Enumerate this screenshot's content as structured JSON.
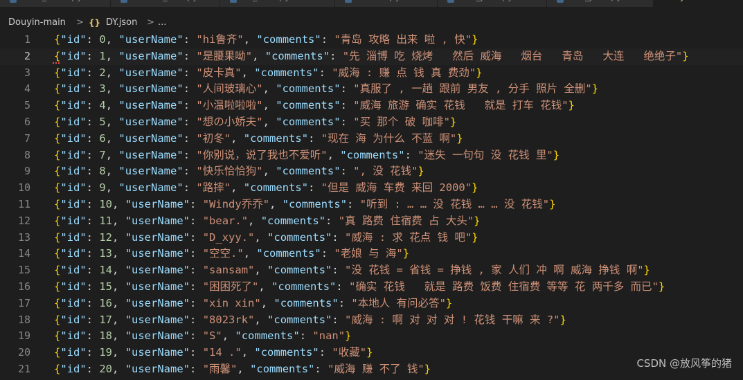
{
  "tabs": [
    {
      "label": "new_alilxt.py",
      "active": false
    },
    {
      "label": "create_dict.py",
      "active": false
    },
    {
      "label": "to_eval.py",
      "active": false
    },
    {
      "label": "model.py",
      "active": false
    },
    {
      "label": "csv_json.py",
      "active": false
    },
    {
      "label": "fen_json.py",
      "active": false
    },
    {
      "label": "DY.json",
      "active": true
    }
  ],
  "breadcrumb": {
    "folder": "Douyin-main",
    "separator": ">",
    "icon": "{}",
    "file": "DY.json",
    "more": "..."
  },
  "colors": {
    "background": "#1e1e1e",
    "key": "#9cdcfe",
    "string": "#ce9178",
    "number": "#b5cea8",
    "bracket": "#ffd700",
    "line_number": "#858585"
  },
  "lines": [
    {
      "num": "1",
      "id": "0",
      "userName": "hi鲁齐",
      "comments": "青岛 攻略 出来 啦 , 快"
    },
    {
      "num": "2",
      "id": "1",
      "userName": "是腰果呦",
      "comments": "先 淄博 吃 烧烤   然后 威海   烟台   青岛   大连   绝绝子"
    },
    {
      "num": "3",
      "id": "2",
      "userName": "皮卡真",
      "comments": "威海 : 赚 点 钱 真 费劲"
    },
    {
      "num": "4",
      "id": "3",
      "userName": "人间玻璃心",
      "comments": "真服了 , 一趟 跟前 男友 , 分手 照片 全删"
    },
    {
      "num": "5",
      "id": "4",
      "userName": "小温啦啦啦",
      "comments": "威海 旅游 确实 花钱   就是 打车 花钱"
    },
    {
      "num": "6",
      "id": "5",
      "userName": "想の小娇夫",
      "comments": "买 那个 破 咖啡"
    },
    {
      "num": "7",
      "id": "6",
      "userName": "初冬",
      "comments": "现在 海 为什么 不蓝 啊"
    },
    {
      "num": "8",
      "id": "7",
      "userName": "你别说，说了我也不爱听",
      "comments": "迷失 一句句 没 花钱 里"
    },
    {
      "num": "9",
      "id": "8",
      "userName": "快乐恰恰狗",
      "comments": ", 没 花钱"
    },
    {
      "num": "10",
      "id": "9",
      "userName": "路摔",
      "comments": "但是 威海 车费 来回 2000"
    },
    {
      "num": "11",
      "id": "10",
      "userName": "Windy乔乔",
      "comments": "听到 : … … 没 花钱 … … 没 花钱"
    },
    {
      "num": "12",
      "id": "11",
      "userName": "bear.",
      "comments": "真 路费 住宿费 占 大头"
    },
    {
      "num": "13",
      "id": "12",
      "userName": "D_xyy.",
      "comments": "威海 : 求 花点 钱 吧"
    },
    {
      "num": "14",
      "id": "13",
      "userName": "空空.",
      "comments": "老娘 与 海"
    },
    {
      "num": "15",
      "id": "14",
      "userName": "sansam",
      "comments": "没 花钱 = 省钱 = 挣钱 , 家 人们 冲 啊 威海 挣钱 啊"
    },
    {
      "num": "16",
      "id": "15",
      "userName": "困困死了",
      "comments": "确实 花钱   就是 路费 饭费 住宿费 等等 花 两千多 而已"
    },
    {
      "num": "17",
      "id": "16",
      "userName": "xin xin",
      "comments": "本地人 有问必答"
    },
    {
      "num": "18",
      "id": "17",
      "userName": "8023rk",
      "comments": "威海 : 啊 对 对 对 ! 花钱 干嘛 来 ?"
    },
    {
      "num": "19",
      "id": "18",
      "userName": "S",
      "comments": "nan"
    },
    {
      "num": "20",
      "id": "19",
      "userName": "14 .",
      "comments": "收藏"
    },
    {
      "num": "21",
      "id": "20",
      "userName": "雨馨",
      "comments": "威海 赚 不了 钱"
    }
  ],
  "watermark": "CSDN @放风筝的猪"
}
